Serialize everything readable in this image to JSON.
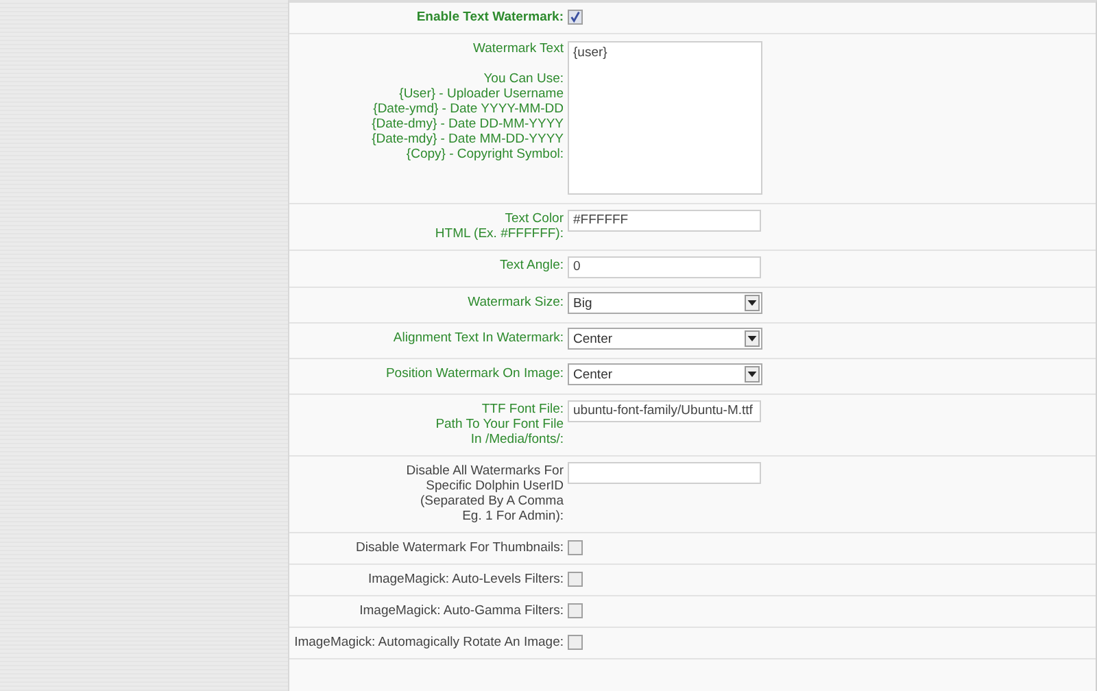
{
  "settings": [
    {
      "kind": "checkbox",
      "label": "Enable Text Watermark:",
      "bold": true,
      "color": "#2e8b2e",
      "checked": true
    },
    {
      "kind": "textarea",
      "label": "Watermark Text\n\nYou Can Use:\n{User} - Uploader Username\n{Date-ymd} - Date YYYY-MM-DD\n{Date-dmy} - Date DD-MM-YYYY\n{Date-mdy} - Date MM-DD-YYYY\n{Copy} - Copyright Symbol:",
      "bold": false,
      "color": "#2e8b2e",
      "value": "{user}"
    },
    {
      "kind": "text",
      "label": "Text Color\nHTML (Ex. #FFFFFF):",
      "bold": false,
      "color": "#2e8b2e",
      "value": "#FFFFFF"
    },
    {
      "kind": "text",
      "label": "Text Angle:",
      "bold": false,
      "color": "#2e8b2e",
      "value": "0"
    },
    {
      "kind": "select",
      "label": "Watermark Size:",
      "bold": false,
      "color": "#2e8b2e",
      "value": "Big"
    },
    {
      "kind": "select",
      "label": "Alignment Text In Watermark:",
      "bold": false,
      "color": "#2e8b2e",
      "value": "Center"
    },
    {
      "kind": "select",
      "label": "Position Watermark On Image:",
      "bold": false,
      "color": "#2e8b2e",
      "value": "Center"
    },
    {
      "kind": "text",
      "label": "TTF Font File:\nPath To Your Font File\nIn /Media/fonts/:",
      "bold": false,
      "color": "#2e8b2e",
      "value": "ubuntu-font-family/Ubuntu-M.ttf"
    },
    {
      "kind": "text",
      "label": "Disable All Watermarks For\nSpecific Dolphin UserID\n(Separated By A Comma\nEg. 1 For Admin):",
      "bold": false,
      "color": "#444444"
    },
    {
      "kind": "checkbox",
      "label": "Disable Watermark For Thumbnails:",
      "bold": false,
      "color": "#444444",
      "checked": false
    },
    {
      "kind": "checkbox",
      "label": "ImageMagick: Auto-Levels Filters:",
      "bold": false,
      "color": "#444444",
      "checked": false
    },
    {
      "kind": "checkbox",
      "label": "ImageMagick: Auto-Gamma Filters:",
      "bold": false,
      "color": "#444444",
      "checked": false
    },
    {
      "kind": "checkbox",
      "label": "ImageMagick: Automagically Rotate An Image:",
      "bold": false,
      "color": "#444444",
      "checked": false
    }
  ]
}
